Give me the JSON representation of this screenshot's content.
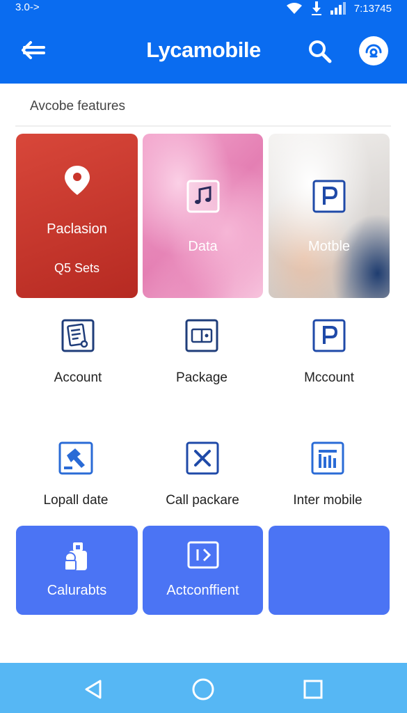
{
  "status_bar": {
    "left_text": "3.0->",
    "time": "7:13745"
  },
  "app_bar": {
    "title": "Lycamobile",
    "back_icon": "arrow-left-icon",
    "search_icon": "search-icon",
    "profile_icon": "profile-icon"
  },
  "section": {
    "title": "Avcobe features"
  },
  "feature_tiles": [
    {
      "label": "Paclasion",
      "sublabel": "Q5 Sets",
      "icon": "location-pin-icon",
      "color": "#c9352b"
    },
    {
      "label": "Data",
      "icon": "music-note-icon"
    },
    {
      "label": "Motble",
      "icon": "parking-icon"
    }
  ],
  "grid_items": [
    {
      "label": "Account",
      "icon": "document-icon"
    },
    {
      "label": "Package",
      "icon": "card-icon"
    },
    {
      "label": "Mccount",
      "icon": "parking-icon"
    },
    {
      "label": "Lopall date",
      "icon": "hammer-icon"
    },
    {
      "label": "Call packare",
      "icon": "close-box-icon"
    },
    {
      "label": "Inter mobile",
      "icon": "bar-chart-icon"
    }
  ],
  "bottom_tiles": [
    {
      "label": "Calurabts",
      "icon": "bottle-icon"
    },
    {
      "label": "Actconffient",
      "icon": "code-icon"
    },
    {
      "label": "",
      "icon": ""
    }
  ],
  "nav_bar": {
    "back": "triangle-back-icon",
    "home": "circle-home-icon",
    "recents": "square-recents-icon"
  },
  "colors": {
    "primary": "#0a6cf0",
    "accent_blue": "#4b74f4",
    "nav_bar": "#56b7f4",
    "red_tile": "#c9352b"
  }
}
